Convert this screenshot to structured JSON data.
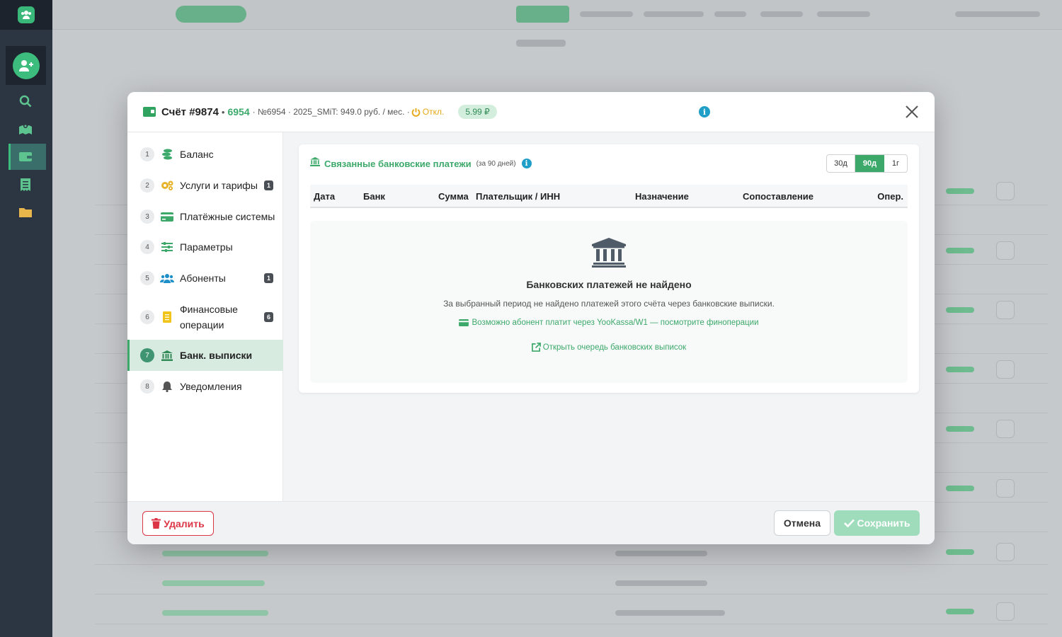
{
  "modal": {
    "title": "Счёт #9874",
    "separator": "•",
    "account_id": "6954",
    "description": "· №6954 · 2025_SMiT: 949.0 руб. / мес. ·",
    "status_off": "Откл.",
    "price_badge": "5.99 ₽"
  },
  "sidebar": {
    "items": [
      {
        "num": "1",
        "label": "Баланс",
        "badge": "",
        "icon": "coins-icon"
      },
      {
        "num": "2",
        "label": "Услуги и тарифы",
        "badge": "1",
        "icon": "cogs-icon"
      },
      {
        "num": "3",
        "label": "Платёжные системы",
        "badge": "",
        "icon": "credit-card-icon"
      },
      {
        "num": "4",
        "label": "Параметры",
        "badge": "",
        "icon": "sliders-icon"
      },
      {
        "num": "5",
        "label": "Абоненты",
        "badge": "1",
        "icon": "users-icon"
      },
      {
        "num": "6",
        "label": "Финансовые операции",
        "badge": "6",
        "icon": "receipt-icon"
      },
      {
        "num": "7",
        "label": "Банк. выписки",
        "badge": "",
        "icon": "bank-icon"
      },
      {
        "num": "8",
        "label": "Уведомления",
        "badge": "",
        "icon": "bell-icon"
      }
    ]
  },
  "card": {
    "title": "Связанные банковские платежи",
    "subtitle": "(за 90 дней)",
    "periods": [
      "30д",
      "90д",
      "1г"
    ],
    "active_period": "90д",
    "columns": [
      "Дата",
      "Банк",
      "Сумма",
      "Плательщик / ИНН",
      "Назначение",
      "Сопоставление",
      "Опер."
    ],
    "empty_title": "Банковских платежей не найдено",
    "empty_text": "За выбранный период не найдено платежей этого счёта через банковские выписки.",
    "empty_link1": "Возможно абонент платит через YooKassa/W1 — посмотрите финоперации",
    "empty_link2": "Открыть очередь банковских выписок"
  },
  "footer": {
    "delete_label": "Удалить",
    "cancel_label": "Отмена",
    "save_label": "Сохранить"
  },
  "colors": {
    "accent": "#3ca96b",
    "danger": "#dc3545",
    "warning": "#e6a817",
    "info": "#1f9fc8",
    "rail": "#2c3542"
  }
}
